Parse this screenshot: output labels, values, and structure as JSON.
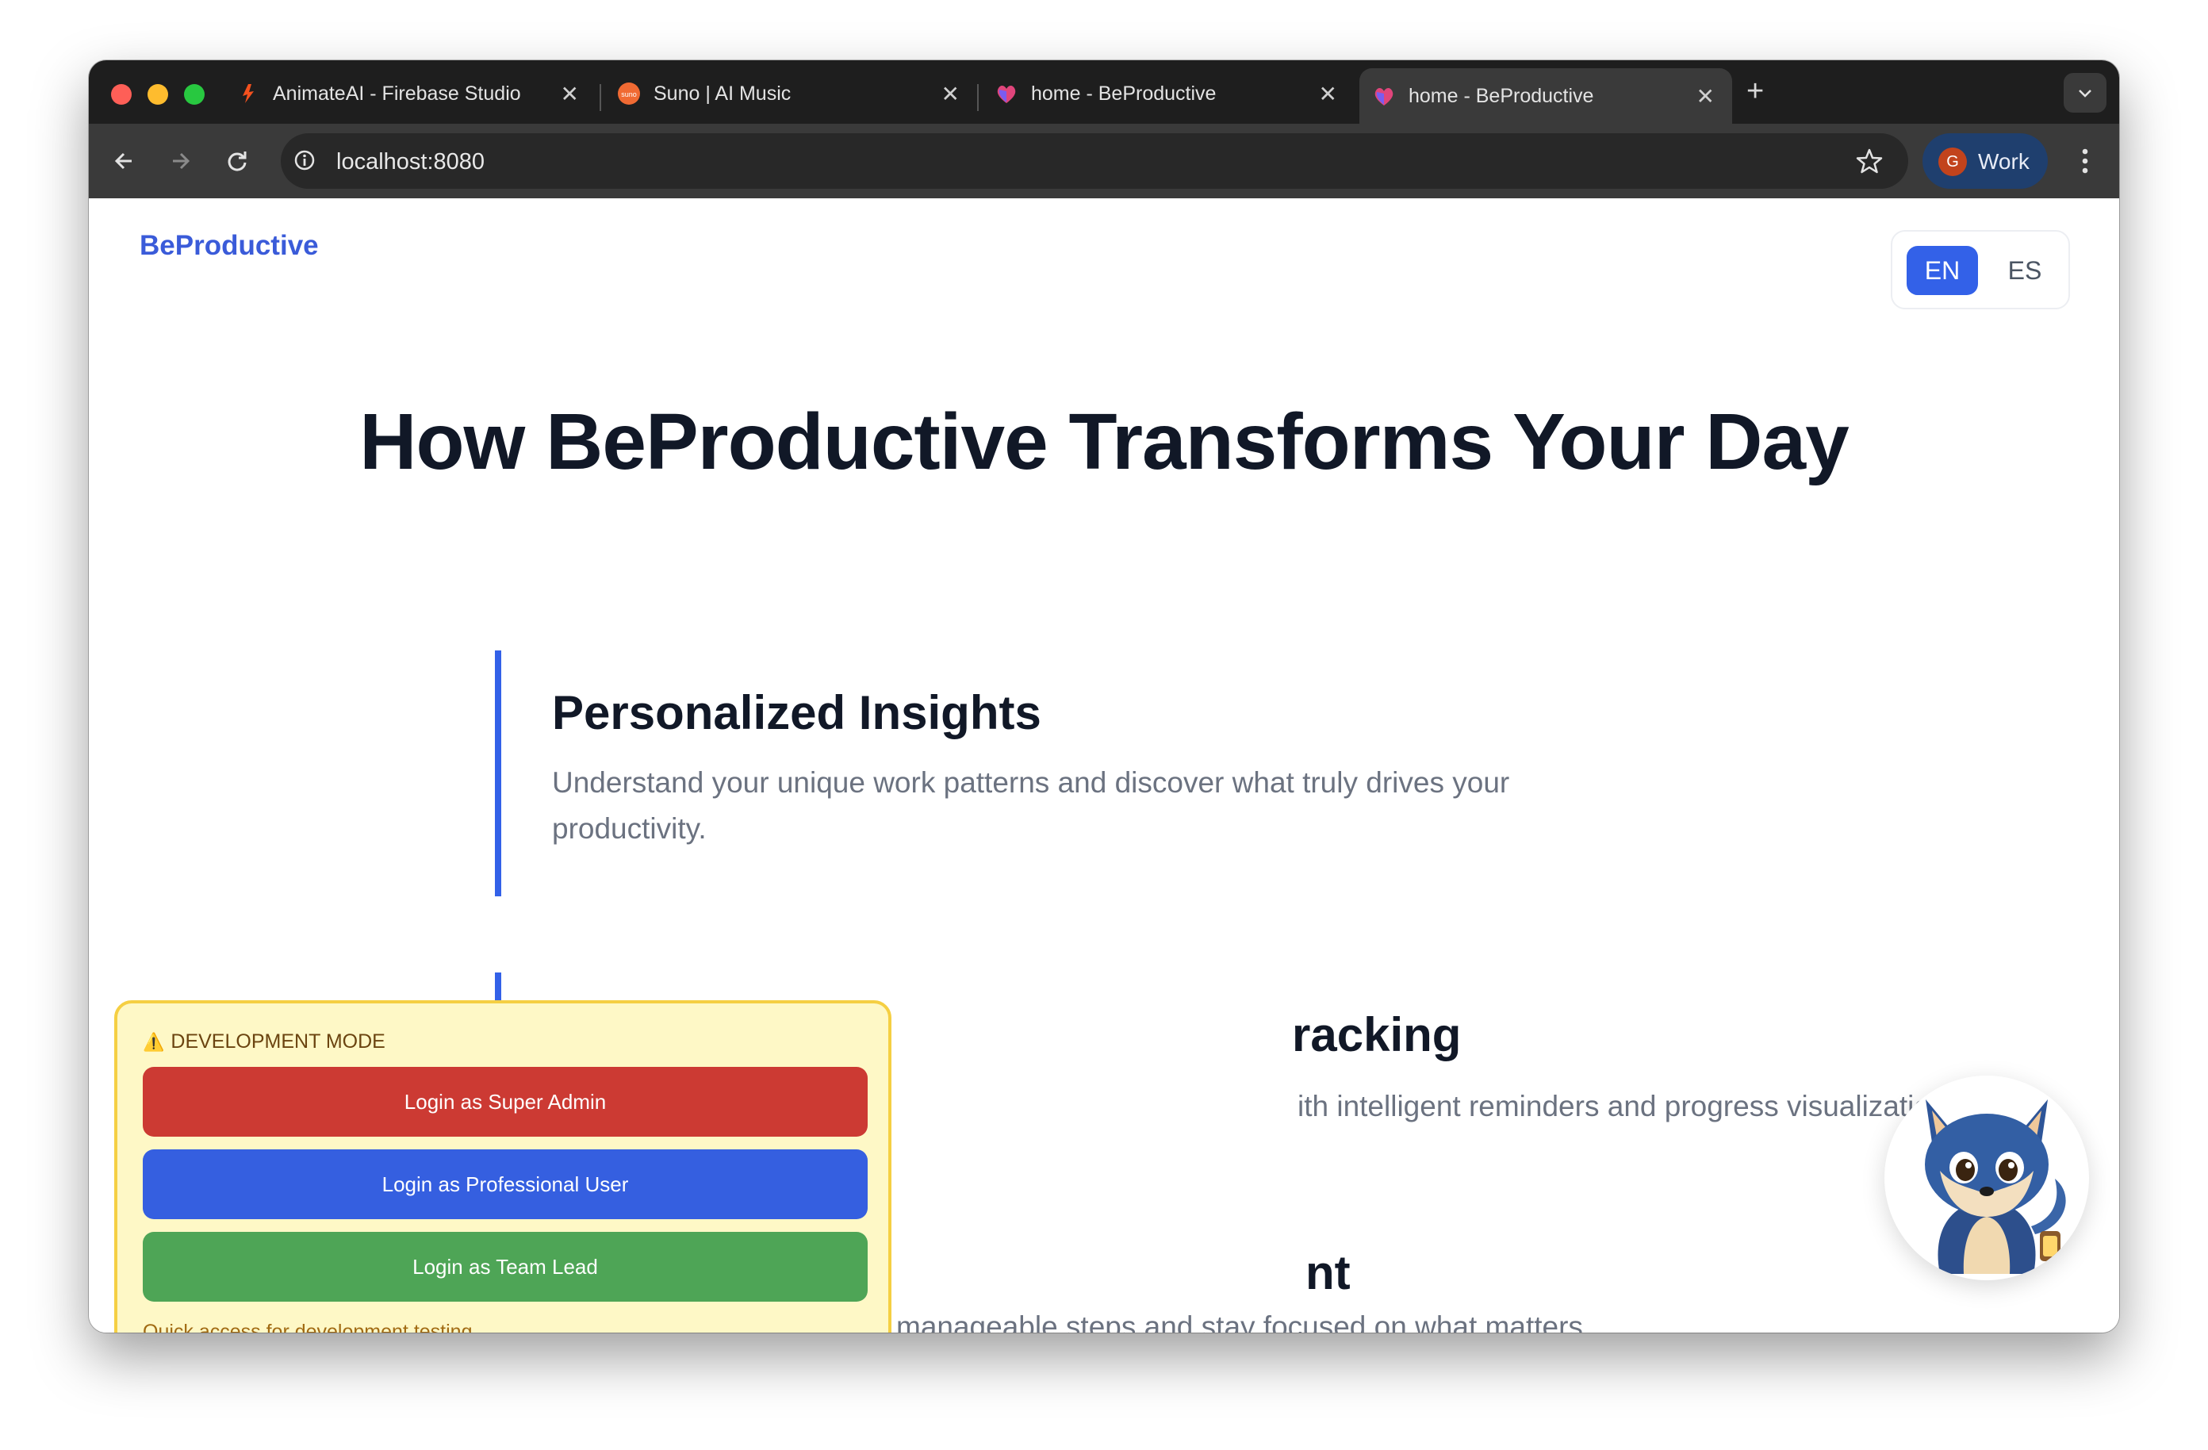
{
  "browser": {
    "tabs": [
      {
        "title": "AnimateAI - Firebase Studio",
        "icon": "firebase-studio-icon",
        "active": false
      },
      {
        "title": "Suno | AI Music",
        "icon": "suno-icon",
        "active": false
      },
      {
        "title": "home - BeProductive",
        "icon": "beproductive-icon",
        "active": false
      },
      {
        "title": "home - BeProductive",
        "icon": "beproductive-icon",
        "active": true
      }
    ],
    "url": "localhost:8080",
    "profile_initial": "G",
    "profile_label": "Work"
  },
  "page": {
    "brand": "BeProductive",
    "lang_options": [
      "EN",
      "ES"
    ],
    "lang_selected": "EN",
    "hero_title": "How BeProductive Transforms Your Day",
    "features": [
      {
        "title": "Personalized Insights",
        "desc": "Understand your unique work patterns and discover what truly drives your productivity."
      },
      {
        "title": "racking",
        "desc": "ith intelligent reminders and progress visualization."
      },
      {
        "title": "nt",
        "desc": "Break down big goals into manageable steps and stay focused on what matters"
      }
    ]
  },
  "dev_panel": {
    "heading": "DEVELOPMENT MODE",
    "buttons": [
      {
        "label": "Login as Super Admin",
        "color": "#cc3a33"
      },
      {
        "label": "Login as Professional User",
        "color": "#355fe0"
      },
      {
        "label": "Login as Team Lead",
        "color": "#4ea556"
      }
    ],
    "footer": "Quick access for development testing"
  },
  "colors": {
    "accent": "#3361e8",
    "brand": "#3a5bd9",
    "dev_panel_bg": "#fef8c6",
    "dev_panel_border": "#f5cf43"
  }
}
